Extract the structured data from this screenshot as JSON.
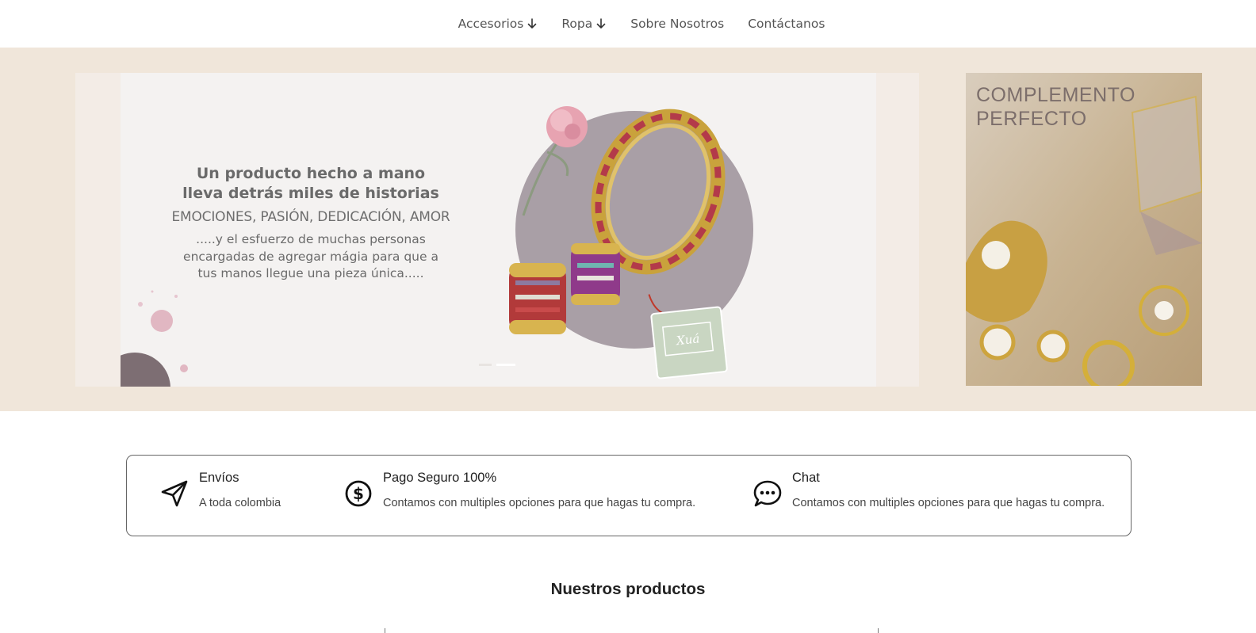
{
  "nav": {
    "items": [
      {
        "label": "Accesorios",
        "has_dropdown": true
      },
      {
        "label": "Ropa",
        "has_dropdown": true
      },
      {
        "label": "Sobre Nosotros",
        "has_dropdown": false
      },
      {
        "label": "Contáctanos",
        "has_dropdown": false
      }
    ]
  },
  "hero": {
    "slide": {
      "title_line1": "Un producto hecho a mano",
      "title_line2": "lleva detrás miles de historias",
      "caps": "EMOCIONES, PASIÓN, DEDICACIÓN, AMOR",
      "body_line1": ".....y el esfuerzo de muchas personas",
      "body_line2": "encargadas de agregar mágia para que a",
      "body_line3": "tus manos llegue una pieza única.....",
      "tag_logo": "Xuá",
      "active_dot": 1,
      "dot_count": 2
    },
    "side_card": {
      "title_line1": "COMPLEMENTO",
      "title_line2": "PERFECTO"
    }
  },
  "features": [
    {
      "icon": "send-icon",
      "title": "Envíos",
      "desc": "A toda colombia"
    },
    {
      "icon": "dollar-circle-icon",
      "title": "Pago Seguro 100%",
      "desc": "Contamos con multiples opciones para que hagas tu compra."
    },
    {
      "icon": "chat-icon",
      "title": "Chat",
      "desc": "Contamos con multiples opciones para que hagas tu compra."
    }
  ],
  "products": {
    "title": "Nuestros productos"
  },
  "colors": {
    "hero_bg": "#f0e6da",
    "slide_bg": "#f4f2f1",
    "accent_mauve": "#a99fa6",
    "text_gray": "#6a6a6a"
  }
}
